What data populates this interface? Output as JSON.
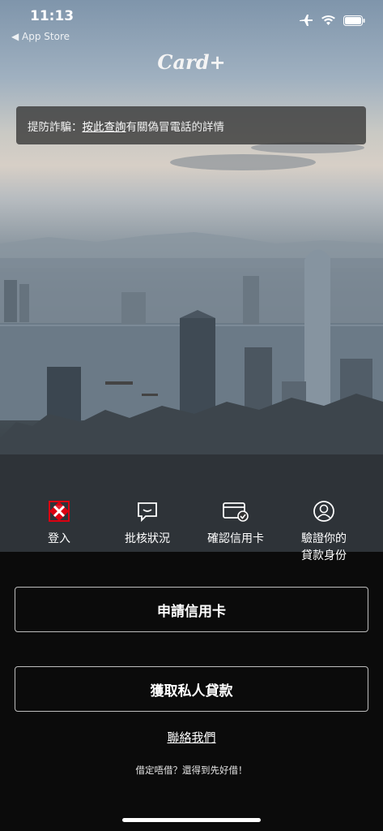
{
  "status_bar": {
    "time": "11:13",
    "back_label": "◀ App Store"
  },
  "brand": {
    "name": "Card+"
  },
  "alert": {
    "prefix": "提防詐騙：",
    "link": "按此查詢",
    "suffix": "有關偽冒電話的詳情"
  },
  "quick_actions": [
    {
      "label": "登入",
      "icon": "brand-logo-icon"
    },
    {
      "label": "批核狀況",
      "icon": "chat-icon"
    },
    {
      "label": "確認信用卡",
      "icon": "card-check-icon"
    },
    {
      "label": "驗證你的\n貸款身份",
      "icon": "user-icon"
    }
  ],
  "buttons": {
    "apply_card": "申請信用卡",
    "personal_loan": "獲取私人貸款"
  },
  "contact": {
    "label": "聯絡我們"
  },
  "tagline": "借定唔借？還得到先好借！",
  "colors": {
    "brand_red": "#db0011",
    "background": "#0b0b0b",
    "alert_bg": "#3c3c3c"
  }
}
